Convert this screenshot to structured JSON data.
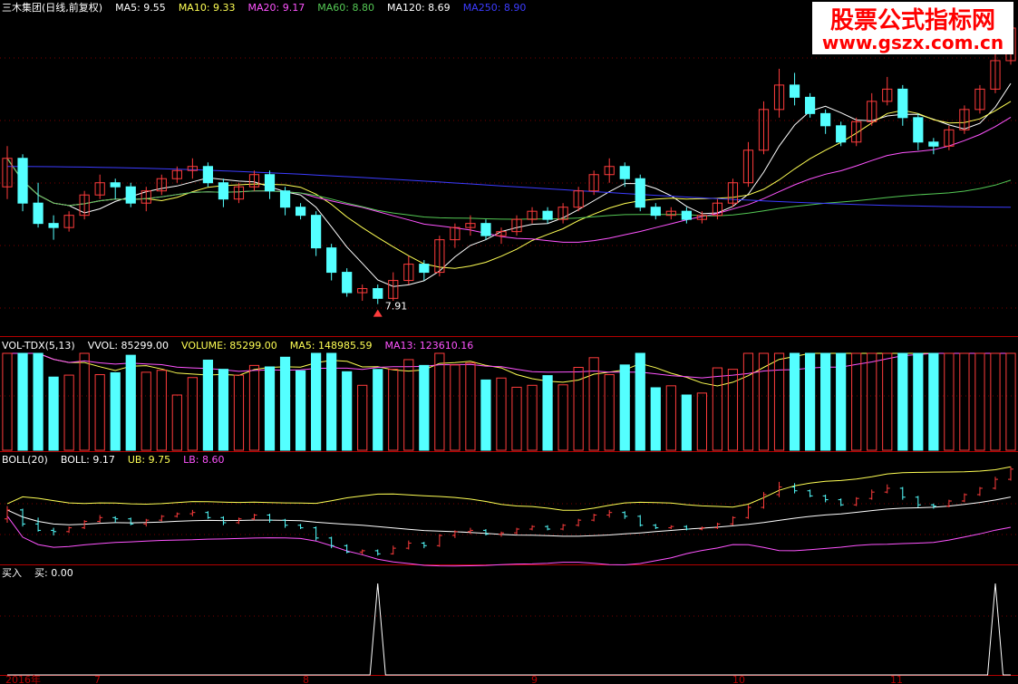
{
  "colors": {
    "background": "#000000",
    "up": "#ff3c3c",
    "down": "#54ffff",
    "white": "#ffffff",
    "yellow": "#ffff54",
    "magenta": "#ff54ff",
    "green": "#54c854",
    "blue": "#3c3cff",
    "separator": "#b40000",
    "grid": "#7a0000",
    "watermark_red": "#ff0000"
  },
  "watermark": {
    "title": "股票公式指标网",
    "url": "www.gszx.com.cn"
  },
  "price_panel": {
    "header": [
      {
        "text": "三木集团(日线,前复权)",
        "color": "#ffffff"
      },
      {
        "text": "MA5: 9.55",
        "color": "#ffffff"
      },
      {
        "text": "MA10: 9.33",
        "color": "#ffff54"
      },
      {
        "text": "MA20: 9.17",
        "color": "#ff54ff"
      },
      {
        "text": "MA60: 8.80",
        "color": "#54c854"
      },
      {
        "text": "MA120: 8.69",
        "color": "#ffffff"
      },
      {
        "text": "MA250: 8.90",
        "color": "#3c3cff"
      }
    ],
    "low_label": "7.91"
  },
  "vol_panel": {
    "header": [
      {
        "text": "VOL-TDX(5,13)",
        "color": "#ffffff"
      },
      {
        "text": "VVOL: 85299.00",
        "color": "#ffffff"
      },
      {
        "text": "VOLUME: 85299.00",
        "color": "#ffff54"
      },
      {
        "text": "MA5: 148985.59",
        "color": "#ffff54"
      },
      {
        "text": "MA13: 123610.16",
        "color": "#ff54ff"
      }
    ]
  },
  "boll_panel": {
    "header": [
      {
        "text": "BOLL(20)",
        "color": "#ffffff"
      },
      {
        "text": "BOLL: 9.17",
        "color": "#ffffff"
      },
      {
        "text": "UB: 9.75",
        "color": "#ffff54"
      },
      {
        "text": "LB: 8.60",
        "color": "#ff54ff"
      }
    ]
  },
  "signal_panel": {
    "header": [
      {
        "text": "买入",
        "color": "#ffffff"
      },
      {
        "text": "买: 0.00",
        "color": "#ffffff"
      }
    ]
  },
  "x_axis": {
    "labels": [
      "2016年",
      "7",
      "8",
      "9",
      "10",
      "11"
    ]
  },
  "chart_data": {
    "type": "candlestick",
    "candles": [
      [
        9.35,
        9.7,
        9.85,
        9.2
      ],
      [
        9.7,
        9.15,
        9.75,
        9.05
      ],
      [
        9.15,
        8.9,
        9.4,
        8.85
      ],
      [
        8.9,
        8.85,
        9.0,
        8.7
      ],
      [
        8.85,
        9.0,
        9.05,
        8.8
      ],
      [
        9.0,
        9.25,
        9.3,
        8.95
      ],
      [
        9.25,
        9.4,
        9.5,
        9.2
      ],
      [
        9.4,
        9.35,
        9.45,
        9.2
      ],
      [
        9.35,
        9.15,
        9.4,
        9.1
      ],
      [
        9.15,
        9.3,
        9.35,
        9.05
      ],
      [
        9.3,
        9.45,
        9.5,
        9.25
      ],
      [
        9.45,
        9.55,
        9.6,
        9.4
      ],
      [
        9.55,
        9.6,
        9.7,
        9.45
      ],
      [
        9.6,
        9.4,
        9.65,
        9.35
      ],
      [
        9.4,
        9.2,
        9.45,
        9.1
      ],
      [
        9.2,
        9.35,
        9.4,
        9.15
      ],
      [
        9.35,
        9.5,
        9.55,
        9.3
      ],
      [
        9.5,
        9.3,
        9.55,
        9.2
      ],
      [
        9.3,
        9.1,
        9.35,
        9.0
      ],
      [
        9.1,
        9.0,
        9.15,
        8.95
      ],
      [
        9.0,
        8.6,
        9.05,
        8.5
      ],
      [
        8.6,
        8.3,
        8.65,
        8.2
      ],
      [
        8.3,
        8.05,
        8.35,
        8.0
      ],
      [
        8.05,
        8.1,
        8.15,
        7.95
      ],
      [
        8.1,
        7.98,
        8.15,
        7.91
      ],
      [
        7.98,
        8.2,
        8.3,
        7.95
      ],
      [
        8.2,
        8.4,
        8.5,
        8.15
      ],
      [
        8.4,
        8.3,
        8.45,
        8.2
      ],
      [
        8.3,
        8.7,
        8.75,
        8.25
      ],
      [
        8.7,
        8.85,
        8.9,
        8.6
      ],
      [
        8.85,
        8.9,
        9.0,
        8.75
      ],
      [
        8.9,
        8.75,
        8.95,
        8.7
      ],
      [
        8.75,
        8.8,
        8.85,
        8.65
      ],
      [
        8.8,
        8.95,
        9.0,
        8.75
      ],
      [
        8.95,
        9.05,
        9.1,
        8.9
      ],
      [
        9.05,
        8.95,
        9.1,
        8.9
      ],
      [
        8.95,
        9.1,
        9.15,
        8.9
      ],
      [
        9.1,
        9.3,
        9.35,
        9.05
      ],
      [
        9.3,
        9.5,
        9.55,
        9.25
      ],
      [
        9.5,
        9.6,
        9.7,
        9.4
      ],
      [
        9.6,
        9.45,
        9.65,
        9.35
      ],
      [
        9.45,
        9.1,
        9.5,
        9.05
      ],
      [
        9.1,
        9.0,
        9.15,
        8.95
      ],
      [
        9.0,
        9.05,
        9.1,
        8.95
      ],
      [
        9.05,
        8.95,
        9.1,
        8.9
      ],
      [
        8.95,
        9.0,
        9.05,
        8.9
      ],
      [
        9.0,
        9.15,
        9.2,
        8.95
      ],
      [
        9.15,
        9.4,
        9.45,
        9.1
      ],
      [
        9.4,
        9.8,
        9.9,
        9.35
      ],
      [
        9.8,
        10.3,
        10.4,
        9.75
      ],
      [
        10.3,
        10.6,
        10.8,
        10.2
      ],
      [
        10.6,
        10.45,
        10.75,
        10.35
      ],
      [
        10.45,
        10.25,
        10.5,
        10.2
      ],
      [
        10.25,
        10.1,
        10.3,
        10.0
      ],
      [
        10.1,
        9.9,
        10.15,
        9.85
      ],
      [
        9.9,
        10.15,
        10.2,
        9.85
      ],
      [
        10.15,
        10.4,
        10.5,
        10.1
      ],
      [
        10.4,
        10.55,
        10.7,
        10.35
      ],
      [
        10.55,
        10.2,
        10.6,
        10.1
      ],
      [
        10.2,
        9.9,
        10.25,
        9.8
      ],
      [
        9.9,
        9.85,
        9.95,
        9.75
      ],
      [
        9.85,
        10.05,
        10.1,
        9.8
      ],
      [
        10.05,
        10.3,
        10.35,
        10.0
      ],
      [
        10.3,
        10.55,
        10.6,
        10.25
      ],
      [
        10.55,
        10.9,
        11.0,
        10.5
      ],
      [
        10.9,
        11.3,
        11.4,
        10.85
      ]
    ],
    "low_marker_index": 24,
    "signal_indices": [
      24,
      64
    ]
  }
}
